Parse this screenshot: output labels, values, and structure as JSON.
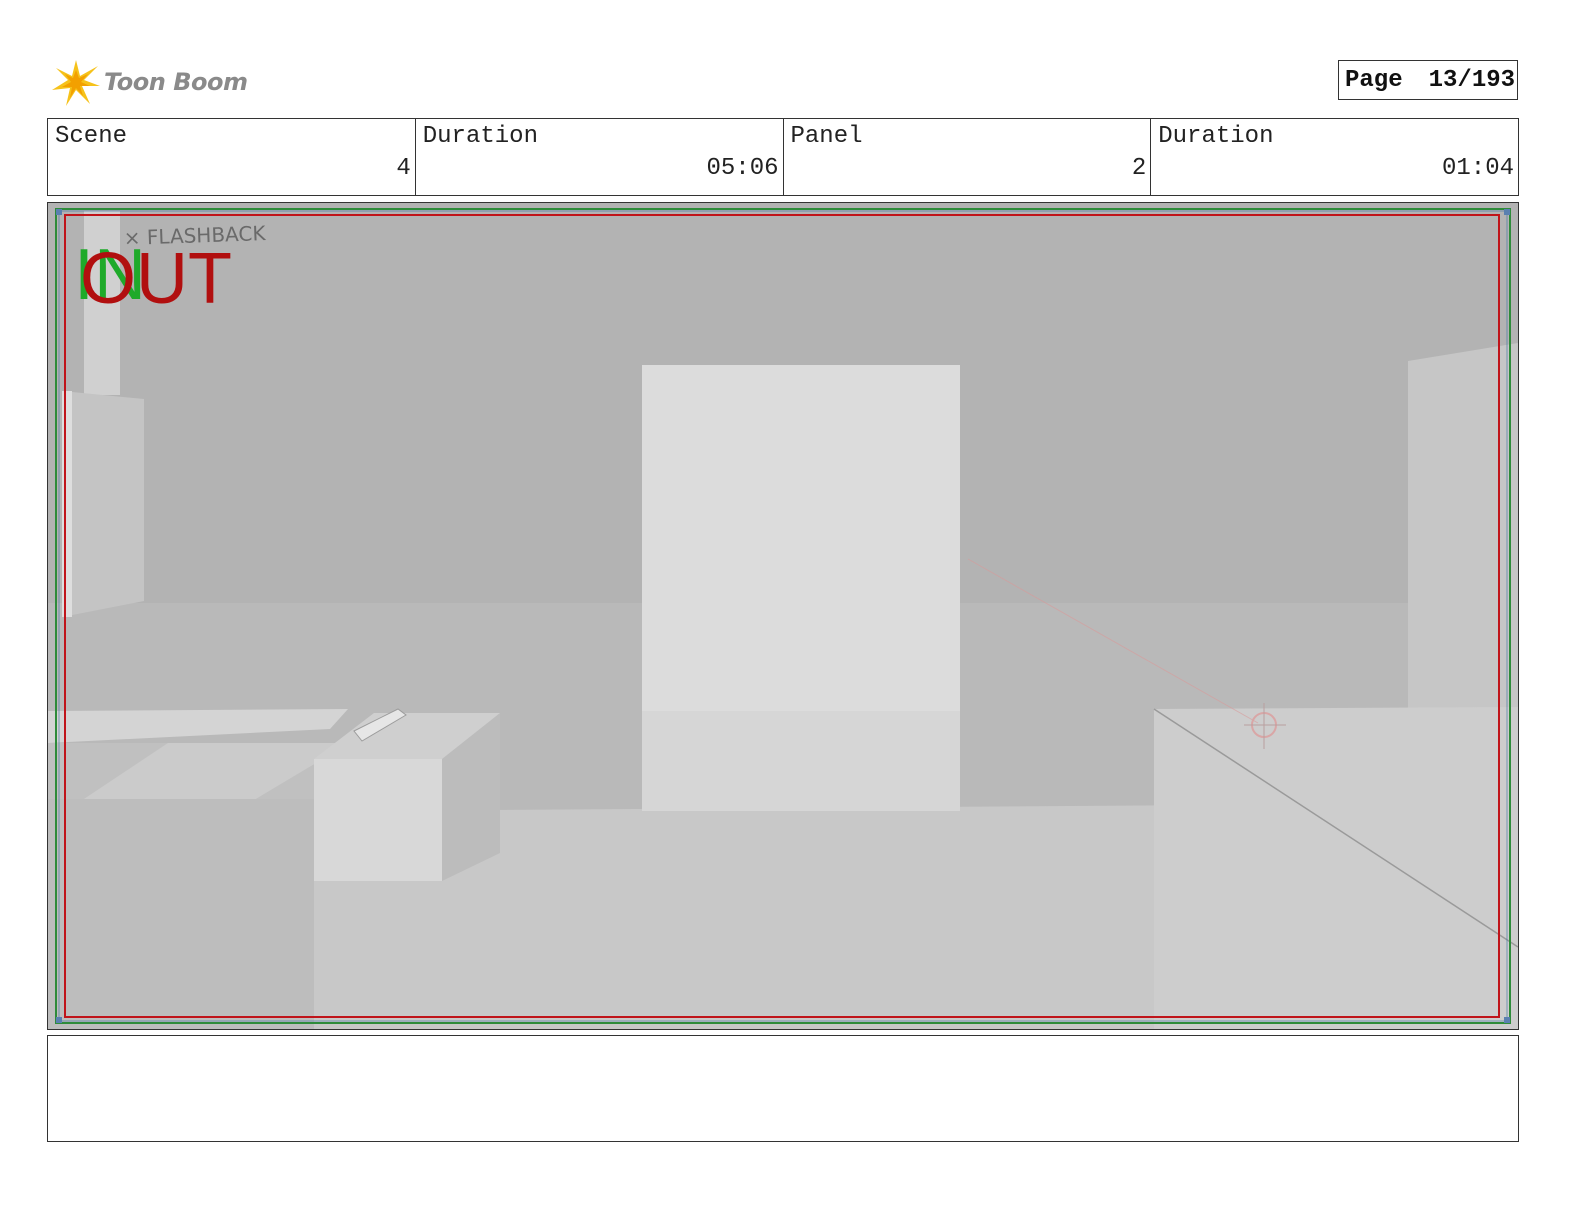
{
  "header": {
    "logo_text": "Toon Boom",
    "page_label": "Page",
    "page_value": "13/193"
  },
  "info": {
    "scene_label": "Scene",
    "scene_value": "4",
    "scene_duration_label": "Duration",
    "scene_duration_value": "05:06",
    "panel_label": "Panel",
    "panel_value": "2",
    "panel_duration_label": "Duration",
    "panel_duration_value": "01:04"
  },
  "panel": {
    "in_marker": "IN",
    "out_marker": "OUT",
    "note": "× FLASHBACK",
    "colors": {
      "in_marker": "#1faa2a",
      "out_marker": "#b10f0f",
      "safe_frame_red": "#c0141a",
      "safe_frame_green": "#2e8b3a"
    }
  },
  "caption": {
    "text": ""
  }
}
